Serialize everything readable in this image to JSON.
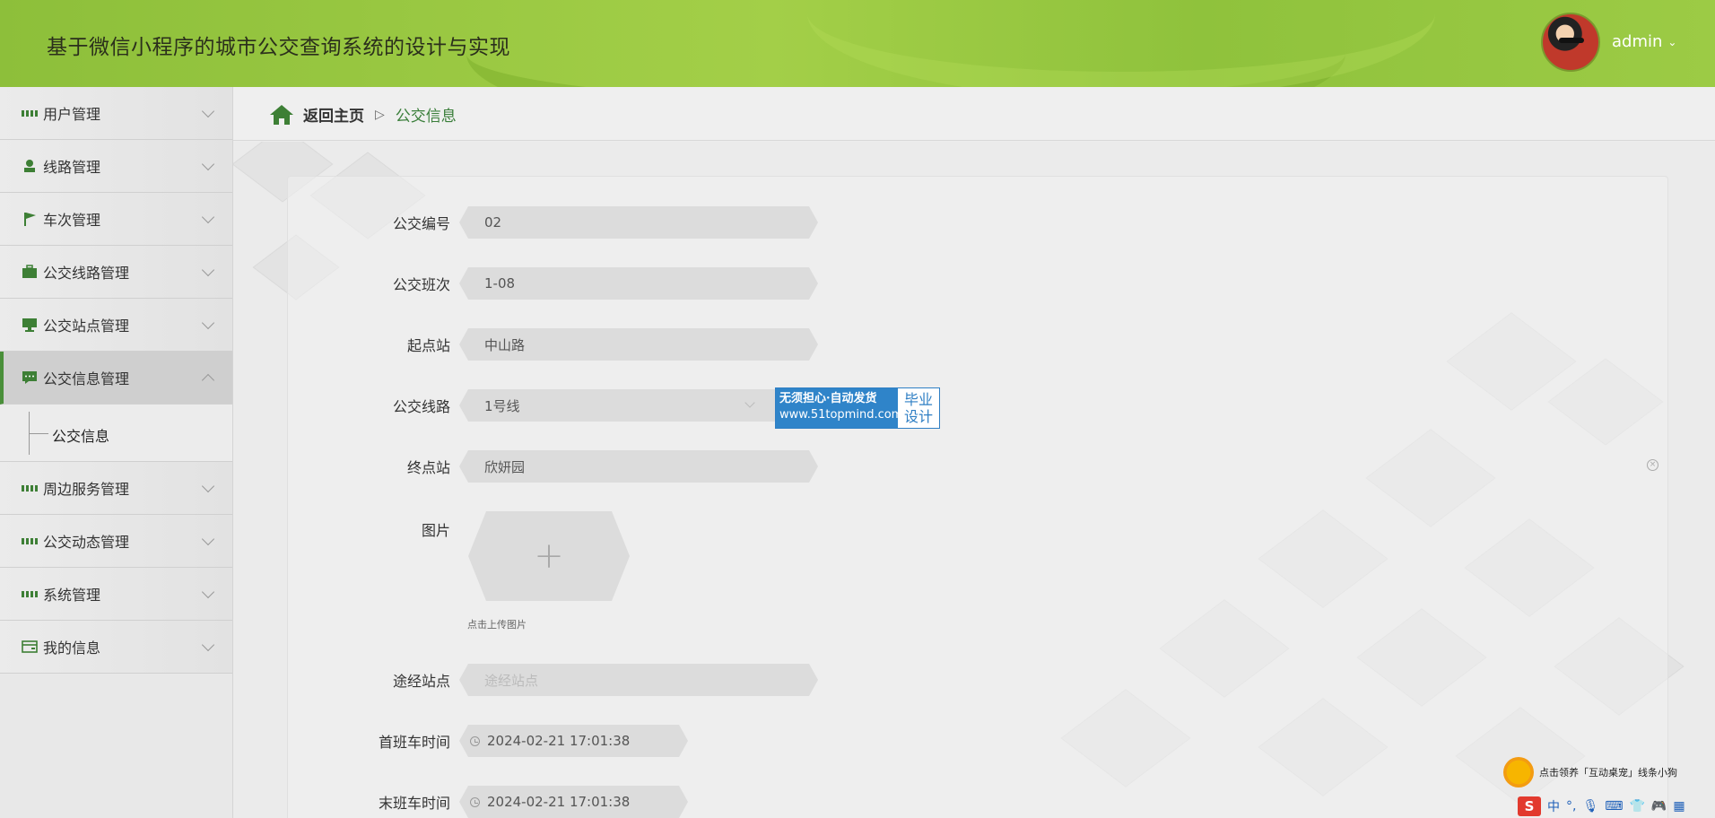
{
  "header": {
    "title": "基于微信小程序的城市公交查询系统的设计与实现",
    "username": "admin"
  },
  "sidebar": {
    "items": [
      {
        "label": "用户管理",
        "icon": "grid-icon"
      },
      {
        "label": "线路管理",
        "icon": "user-icon"
      },
      {
        "label": "车次管理",
        "icon": "flag-icon"
      },
      {
        "label": "公交线路管理",
        "icon": "briefcase-icon"
      },
      {
        "label": "公交站点管理",
        "icon": "monitor-icon"
      },
      {
        "label": "公交信息管理",
        "icon": "chat-icon",
        "active": true
      },
      {
        "label": "周边服务管理",
        "icon": "grid-icon"
      },
      {
        "label": "公交动态管理",
        "icon": "grid-icon"
      },
      {
        "label": "系统管理",
        "icon": "grid-icon"
      },
      {
        "label": "我的信息",
        "icon": "card-icon"
      }
    ],
    "submenu": {
      "label": "公交信息"
    }
  },
  "breadcrumb": {
    "home": "返回主页",
    "current": "公交信息"
  },
  "form": {
    "bus_no": {
      "label": "公交编号",
      "value": "02"
    },
    "shift": {
      "label": "公交班次",
      "value": "1-08"
    },
    "start": {
      "label": "起点站",
      "value": "中山路"
    },
    "line": {
      "label": "公交线路",
      "value": "1号线"
    },
    "end": {
      "label": "终点站",
      "value": "欣妍园"
    },
    "image": {
      "label": "图片",
      "upload_tip": "点击上传图片"
    },
    "via": {
      "label": "途经站点",
      "placeholder": "途经站点"
    },
    "first_time": {
      "label": "首班车时间",
      "value": "2024-02-21 17:01:38"
    },
    "last_time": {
      "label": "末班车时间",
      "value": "2024-02-21 17:01:38"
    }
  },
  "ad": {
    "line1": "无须担心·自动发货",
    "line2": "www.51topmind.com",
    "right1": "毕业",
    "right2": "设计"
  },
  "ime": {
    "tip": "点击领养「互动桌宠」线条小狗",
    "logo": "S",
    "mode": "中"
  },
  "colors": {
    "header": "#9ccb45",
    "accent": "#3d7f35",
    "breadcrumb_current": "#3a7e3a"
  }
}
